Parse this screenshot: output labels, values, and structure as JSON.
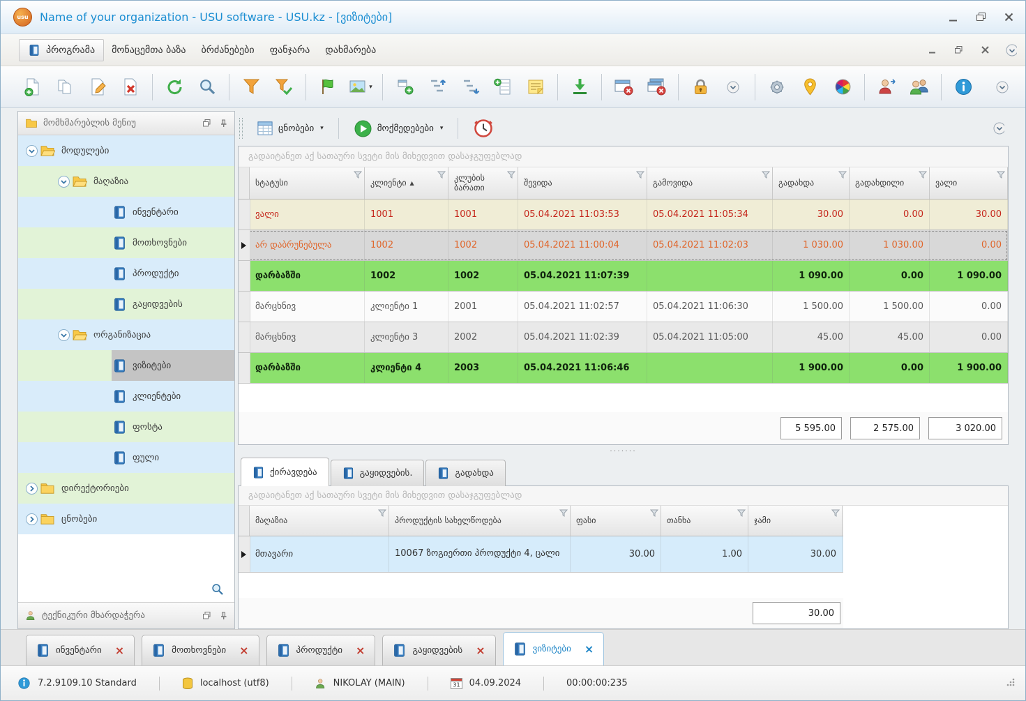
{
  "titlebar": {
    "title": "Name of your organization - USU software - USU.kz - [ვიზიტები]",
    "logo": "usu"
  },
  "menubar": {
    "items": [
      "პროგრამა",
      "მონაცემთა ბაზა",
      "ბრძანებები",
      "ფანჯარა",
      "დახმარება"
    ]
  },
  "toolbar": {
    "icons": [
      "new-document",
      "copy",
      "edit",
      "delete",
      "refresh",
      "search",
      "filter",
      "filter-settings",
      "flag",
      "image",
      "add-subtree",
      "expand-tree",
      "collapse-tree",
      "add-record",
      "notes",
      "export",
      "close-window",
      "close-all-windows",
      "lock",
      "dropdown-circle",
      "settings",
      "location",
      "colors",
      "change-user",
      "users",
      "info",
      "customize"
    ]
  },
  "sidebar": {
    "header": "მომხმარებლის მენიუ",
    "support": "ტექნიკური მხარდაჭერა",
    "tree": [
      {
        "label": "მოდულები"
      },
      {
        "label": "მაღაზია"
      },
      {
        "label": "ინვენტარი"
      },
      {
        "label": "მოთხოვნები"
      },
      {
        "label": "პროდუქტი"
      },
      {
        "label": "გაყიდვების"
      },
      {
        "label": "ორგანიზაცია"
      },
      {
        "label": "ვიზიტები"
      },
      {
        "label": "კლიენტები"
      },
      {
        "label": "ფოსტა"
      },
      {
        "label": "ფული"
      },
      {
        "label": "დირექტორიები"
      },
      {
        "label": "ცნობები"
      }
    ]
  },
  "subtoolbar": {
    "reports": "ცნობები",
    "actions": "მოქმედებები"
  },
  "main_table": {
    "group_hint": "გადაიტანეთ აქ სათაური სვეტი მის მიხედვით დასაჯგუფებლად",
    "columns": [
      "სტატუსი",
      "კლიენტი",
      "კლუბის ბარათი",
      "შევიდა",
      "გამოვიდა",
      "გადახდა",
      "გადახდილი",
      "ვალი"
    ],
    "rows": [
      {
        "cells": [
          "ვალი",
          "1001",
          "1001",
          "05.04.2021 11:03:53",
          "05.04.2021 11:05:34",
          "30.00",
          "0.00",
          "30.00"
        ]
      },
      {
        "cells": [
          "არ დაბრუნებულა",
          "1002",
          "1002",
          "05.04.2021 11:00:04",
          "05.04.2021 11:02:03",
          "1 030.00",
          "1 030.00",
          "0.00"
        ]
      },
      {
        "cells": [
          "დარბაზში",
          "1002",
          "1002",
          "05.04.2021 11:07:39",
          "",
          "1 090.00",
          "0.00",
          "1 090.00"
        ]
      },
      {
        "cells": [
          "მარცხნივ",
          "კლიენტი 1",
          "2001",
          "05.04.2021 11:02:57",
          "05.04.2021 11:06:30",
          "1 500.00",
          "1 500.00",
          "0.00"
        ]
      },
      {
        "cells": [
          "მარცხნივ",
          "კლიენტი 3",
          "2002",
          "05.04.2021 11:02:39",
          "05.04.2021 11:05:00",
          "45.00",
          "45.00",
          "0.00"
        ]
      },
      {
        "cells": [
          "დარბაზში",
          "კლიენტი 4",
          "2003",
          "05.04.2021 11:06:46",
          "",
          "1 900.00",
          "0.00",
          "1 900.00"
        ]
      }
    ],
    "summary": [
      "5 595.00",
      "2 575.00",
      "3 020.00"
    ]
  },
  "detail": {
    "tabs": [
      "ქირავდება",
      "გაყიდვების.",
      "გადახდა"
    ],
    "group_hint": "გადაიტანეთ აქ სათაური სვეტი მის მიხედვით დასაჯგუფებლად",
    "columns": [
      "მაღაზია",
      "პროდუქტის სახელწოდება",
      "ფასი",
      "თანხა",
      "ჯამი"
    ],
    "rows": [
      {
        "cells": [
          "მთავარი",
          "10067 ზოგიერთი პროდუქტი 4, ცალი",
          "30.00",
          "1.00",
          "30.00"
        ]
      }
    ],
    "summary": "30.00"
  },
  "doc_tabs": [
    "ინვენტარი",
    "მოთხოვნები",
    "პროდუქტი",
    "გაყიდვების",
    "ვიზიტები"
  ],
  "statusbar": {
    "version": "7.2.9109.10 Standard",
    "database": "localhost (utf8)",
    "user": "NIKOLAY (MAIN)",
    "calendar_day": "31",
    "date": "04.09.2024",
    "timer": "00:00:00:235"
  },
  "colors": {
    "title_text": "#1b8ed2",
    "row_debt_text": "#c5271c",
    "row_not_returned_text": "#e0652a",
    "row_in_hall_bg": "#8ce06d",
    "selected_row_bg": "#d8d8d8",
    "detail_row_bg": "#d6ecfb",
    "tree_stripe_blue": "#d9ecfa",
    "tree_stripe_green": "#e2f3d7"
  }
}
